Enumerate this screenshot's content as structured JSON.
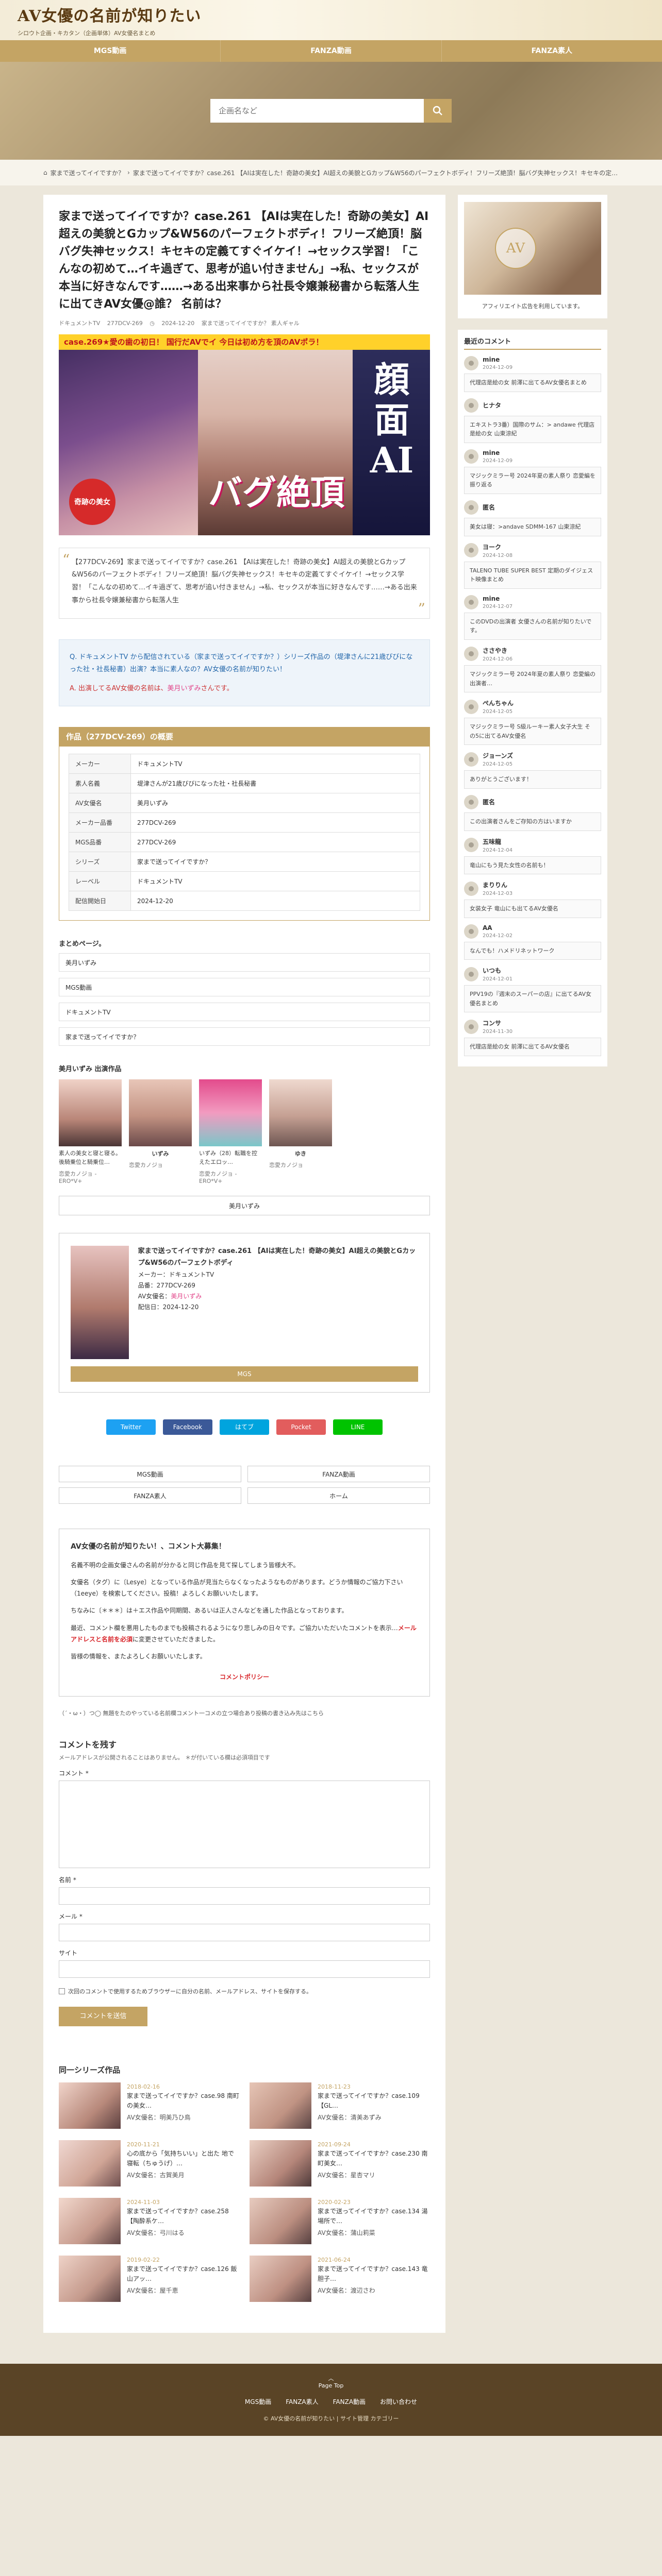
{
  "site": {
    "logo": "AV女優の名前が知りたい",
    "tagline": "シロウト企画・キカタン（企画単体）AV女優名まとめ",
    "nav": [
      "MGS動画",
      "FANZA動画",
      "FANZA素人"
    ],
    "search_placeholder": "企画名など"
  },
  "breadcrumb": {
    "home": "家まで送ってイイですか？",
    "sep": "›",
    "current": "家まで送ってイイですか？case.261 【AIは実在した！奇跡の美女】AI超えの美貌とGカップ&W56のパーフェクトボディ！フリーズ絶頂！脳バグ失神セックス！キセキの定…"
  },
  "post": {
    "title": "家まで送ってイイですか？case.261 【AIは実在した！奇跡の美女】AI超えの美貌とGカップ&W56のパーフェクトボディ！フリーズ絶頂！脳バグ失神セックス！キセキの定義てすぐイケイ！→セックス学習！「こんなの初めて…イキ過ぎて、思考が追い付きません」→私、セックスが本当に好きなんです……→ある出来事から社長令嬢兼秘書から転落人生に出てきAV女優@誰？ 名前は？",
    "author": "ドキュメントTV",
    "code": "277DCV-269",
    "date_line": "2024-12-20",
    "meta_extra": "家まで送ってイイですか？ 素人ギャル",
    "quote": "【277DCV-269】家まで送ってイイですか？case.261 【AIは実在した！奇跡の美女】AI超えの美貌とGカップ&W56のパーフェクトボディ！フリーズ絶頂！脳バグ失神セックス！キセキの定義てすぐイケイ！→セックス学習！「こんなの初めて…イキ過ぎて、思考が追い付きません」→私、セックスが本当に好きなんです……→ある出来事から社長令嬢兼秘書から転落人生",
    "q": "ドキュメントTV から配信されている（家まで送ってイイですか？）シリーズ作品の（堤津さんに21歳びびになった社・社長秘書）出演？本当に素人なの？AV女優の名前が知りたい！",
    "a_prefix": "出演してるAV女優の名前は、",
    "a_name": "美月いずみ",
    "a_suffix": "さんです。"
  },
  "eyecatch": {
    "top": "case.269★愛の歯の初日！ 国行だAVでイ 今日は初め方を頂のAVポラ！",
    "big": "顔面AI",
    "bug": "バグ絶頂",
    "hime": "奇跡の美女"
  },
  "spec": {
    "head": "作品（277DCV-269）の概要",
    "rows": [
      {
        "k": "メーカー",
        "v": "ドキュメントTV"
      },
      {
        "k": "素人名義",
        "v": "堤津さんが21歳びびになった社・社長秘書"
      },
      {
        "k": "AV女優名",
        "v": "美月いずみ"
      },
      {
        "k": "メーカー品番",
        "v": "277DCV-269"
      },
      {
        "k": "MGS品番",
        "v": "277DCV-269"
      },
      {
        "k": "シリーズ",
        "v": "家まで送ってイイですか？"
      },
      {
        "k": "レーベル",
        "v": "ドキュメントTV"
      },
      {
        "k": "配信開始日",
        "v": "2024-12-20"
      }
    ]
  },
  "tags": {
    "heading": "まとめページ。",
    "items": [
      "美月いずみ",
      "MGS動画",
      "ドキュメントTV",
      "家まで送ってイイですか？"
    ]
  },
  "actress": {
    "heading": "美月いずみ 出演作品",
    "items": [
      {
        "name": "",
        "desc": "素人の美女と寝と寝る。後騎乗位と騎乗位…",
        "src": "恋愛カノジョ - ERO*V+"
      },
      {
        "name": "いずみ",
        "desc": "",
        "src": "恋愛カノジョ"
      },
      {
        "name": "",
        "desc": "いずみ（28）転職を控えたエロッ…",
        "src": "恋愛カノジョ - ERO*V+"
      },
      {
        "name": "ゆき",
        "desc": "",
        "src": "恋愛カノジョ"
      }
    ],
    "more": "美月いずみ"
  },
  "card": {
    "title": "家まで送ってイイですか？case.261 【AIは実在した！奇跡の美女】AI超えの美貌とGカップ&W56のパーフェクトボディ",
    "maker": "メーカー：ドキュメントTV",
    "code": "品番：277DCV-269",
    "actress_label": "AV女優名：",
    "actress": "美月いずみ",
    "date": "配信日：2024-12-20",
    "btn": "MGS"
  },
  "share": [
    "Twitter",
    "Facebook",
    "はてブ",
    "Pocket",
    "LINE"
  ],
  "links": [
    "MGS動画",
    "FANZA動画",
    "FANZA素人",
    "ホーム"
  ],
  "comment": {
    "title": "AV女優の名前が知りたい！、コメント大募集！",
    "p1": "名義不明の企画女優さんの名前が分かると同じ作品を見て探してしまう皆様大不。",
    "p2": "女優名（タグ）に〔Lesye〕となっている作品が見当たらなくなったようなものがあります。どうか情報のご協力下さい（1eeye）を検索してください。投稿！よろしくお願いいたします。",
    "p3": "ちなみに〔＊＊＊〕は＋エス作品や同期間、あるいは正人さんなどを通した作品となっております。",
    "p4_pre": "最近、コメント欄を悪用したものまでも投稿されるようになり悲しみの日々です。ご協力いただいたコメントを表示…",
    "p4_red": "メールアドレスと名前を必須",
    "p4_post": "に変更させていただきました。",
    "thanks": "皆様の情報を、またよろしくお願いいたします。",
    "policy": "コメントポリシー"
  },
  "rss_note": "（´・ω・）つ◯ 無題をたのやっている名前欄コメント一コメの立つ場合あり投稿の書き込み先はこちら",
  "respond": {
    "title": "コメントを残す",
    "note": "メールアドレスが公開されることはありません。 ＊が付いている欄は必須項目です",
    "comment_label": "コメント *",
    "name_label": "名前 *",
    "mail_label": "メール *",
    "site_label": "サイト",
    "check": "次回のコメントで使用するためブラウザーに自分の名前、メールアドレス、サイトを保存する。",
    "submit": "コメントを送信"
  },
  "series": {
    "title": "同一シリーズ作品",
    "items": [
      {
        "date": "2018-02-16",
        "title": "家まで送ってイイですか？case.98 南町の美女…",
        "actress": "AV女優名：明美乃ひ鳥"
      },
      {
        "date": "2018-11-23",
        "title": "家まで送ってイイですか？case.109【GL…",
        "actress": "AV女優名：清美あずみ"
      },
      {
        "date": "2020-11-21",
        "title": "心の底から「気持ちいい」と出た 地で寝転（ちゅうげ）…",
        "actress": "AV女優名：古賀美月"
      },
      {
        "date": "2021-09-24",
        "title": "家まで送ってイイですか？case.230 南町美女…",
        "actress": "AV女優名：星杏マリ"
      },
      {
        "date": "2024-11-03",
        "title": "家まで送ってイイですか？case.258【陶酔系ケ…",
        "actress": "AV女優名：弓川はる"
      },
      {
        "date": "2020-02-23",
        "title": "家まで送ってイイですか？case.134 湯場所で…",
        "actress": "AV女優名：蒲山莉菜"
      },
      {
        "date": "2019-02-22",
        "title": "家まで送ってイイですか？case.126 飯山アッ…",
        "actress": "AV女優名：屋千恵"
      },
      {
        "date": "2021-06-24",
        "title": "家まで送ってイイですか？case.143 竜胆子…",
        "actress": "AV女優名：渡辺さわ"
      }
    ]
  },
  "sidebar": {
    "ad_logo": "AV",
    "ad_caption": "アフィリエイト広告を利用しています。",
    "recent_title": "最近のコメント",
    "comments": [
      {
        "name": "mine",
        "date": "2024-12-09",
        "body": "代理店是絵の女 前澤に出てるAV女優名まとめ"
      },
      {
        "name": "ヒナタ",
        "date": "",
        "body": "エキストラ3番）国際のサム：> andawe 代理店是絵の女 山東涼紀"
      },
      {
        "name": "mine",
        "date": "2024-12-09",
        "body": "マジックミラー号 2024年夏の素人祭り 恋愛編を振り返る"
      },
      {
        "name": "匿名",
        "date": "",
        "body": "美女は寝：>andave SDMM-167 山東涼紀"
      },
      {
        "name": "ヨーク",
        "date": "2024-12-08",
        "body": "TALENO TUBE SUPER BEST 定期のダイジェスト映像まとめ"
      },
      {
        "name": "mine",
        "date": "2024-12-07",
        "body": "このDVDの出演者 女優さんの名前が知りたいです。"
      },
      {
        "name": "ささやき",
        "date": "2024-12-06",
        "body": "マジックミラー号 2024年夏の素人祭り 恋愛編の出演者…"
      },
      {
        "name": "ぺんちゃん",
        "date": "2024-12-05",
        "body": "マジックミラー号 S級ルーキー素人女子大生 その5に出てるAV女優名"
      },
      {
        "name": "ジョーンズ",
        "date": "2024-12-05",
        "body": "ありがとうございます！"
      },
      {
        "name": "匿名",
        "date": "",
        "body": "この出演者さんをご存知の方はいますか"
      },
      {
        "name": "五味龍",
        "date": "2024-12-04",
        "body": "竜山にもう見た女性の名前も！"
      },
      {
        "name": "まりりん",
        "date": "2024-12-03",
        "body": "女装女子 竜山にも出てるAV女優名"
      },
      {
        "name": "AA",
        "date": "2024-12-02",
        "body": "なんでも！ハメドリネットワーク"
      },
      {
        "name": "いつも",
        "date": "2024-12-01",
        "body": "PPV19の『週末のスーパーの店』に出てるAV女優名まとめ"
      },
      {
        "name": "コンサ",
        "date": "2024-11-30",
        "body": "代理店是絵の女 前澤に出てるAV女優名"
      }
    ]
  },
  "footer": {
    "pagetop": "Page Top",
    "links": [
      "MGS動画",
      "FANZA素人",
      "FANZA動画",
      "お問い合わせ"
    ],
    "copyright": "© AV女優の名前が知りたい | サイト管理 カテゴリー"
  }
}
